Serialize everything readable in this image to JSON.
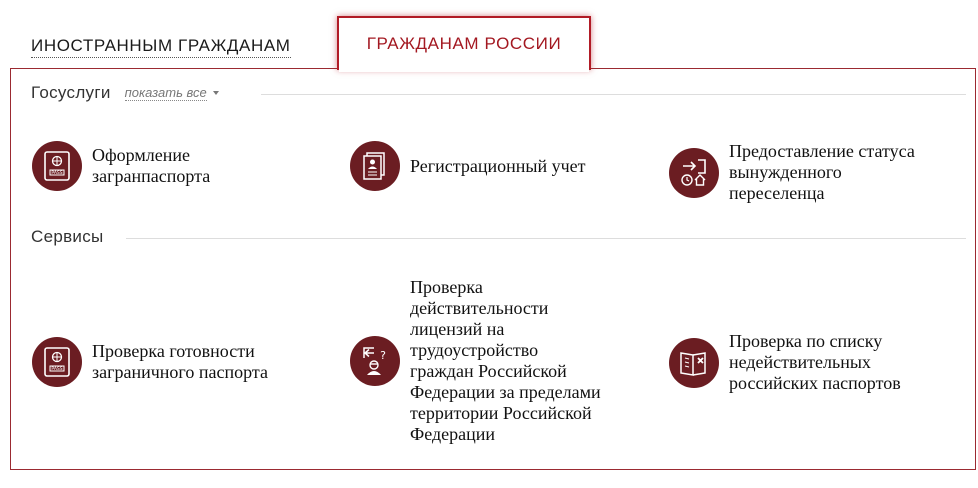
{
  "tabs": {
    "foreign": "ИНОСТРАННЫМ ГРАЖДАНАМ",
    "russia": "ГРАЖДАНАМ РОССИИ"
  },
  "gosuslugi": {
    "title": "Госуслуги",
    "show_all": "показать все",
    "items": [
      {
        "label": "Оформление\nзагранпаспорта",
        "icon": "passport-icon"
      },
      {
        "label": "Регистрационный учет",
        "icon": "registration-document-icon"
      },
      {
        "label": "Предоставление статуса\nвынужденного\nпереселенца",
        "icon": "resettlement-arrow-clock-house-icon"
      }
    ]
  },
  "services": {
    "title": "Сервисы",
    "items": [
      {
        "label": "Проверка готовности\nзаграничного паспорта",
        "icon": "passport-icon"
      },
      {
        "label": "Проверка\nдействительности\nлицензий на\nтрудоустройство\nграждан Российской\nФедерации за пределами\nтерритории Российской\nФедерации",
        "icon": "worker-license-check-icon"
      },
      {
        "label": "Проверка по списку\nнедействительных\nроссийских паспортов",
        "icon": "invalid-passport-book-icon"
      }
    ]
  },
  "colors": {
    "accent": "#a31821",
    "icon_bg": "#6b1d22",
    "border": "#9b2a31"
  }
}
